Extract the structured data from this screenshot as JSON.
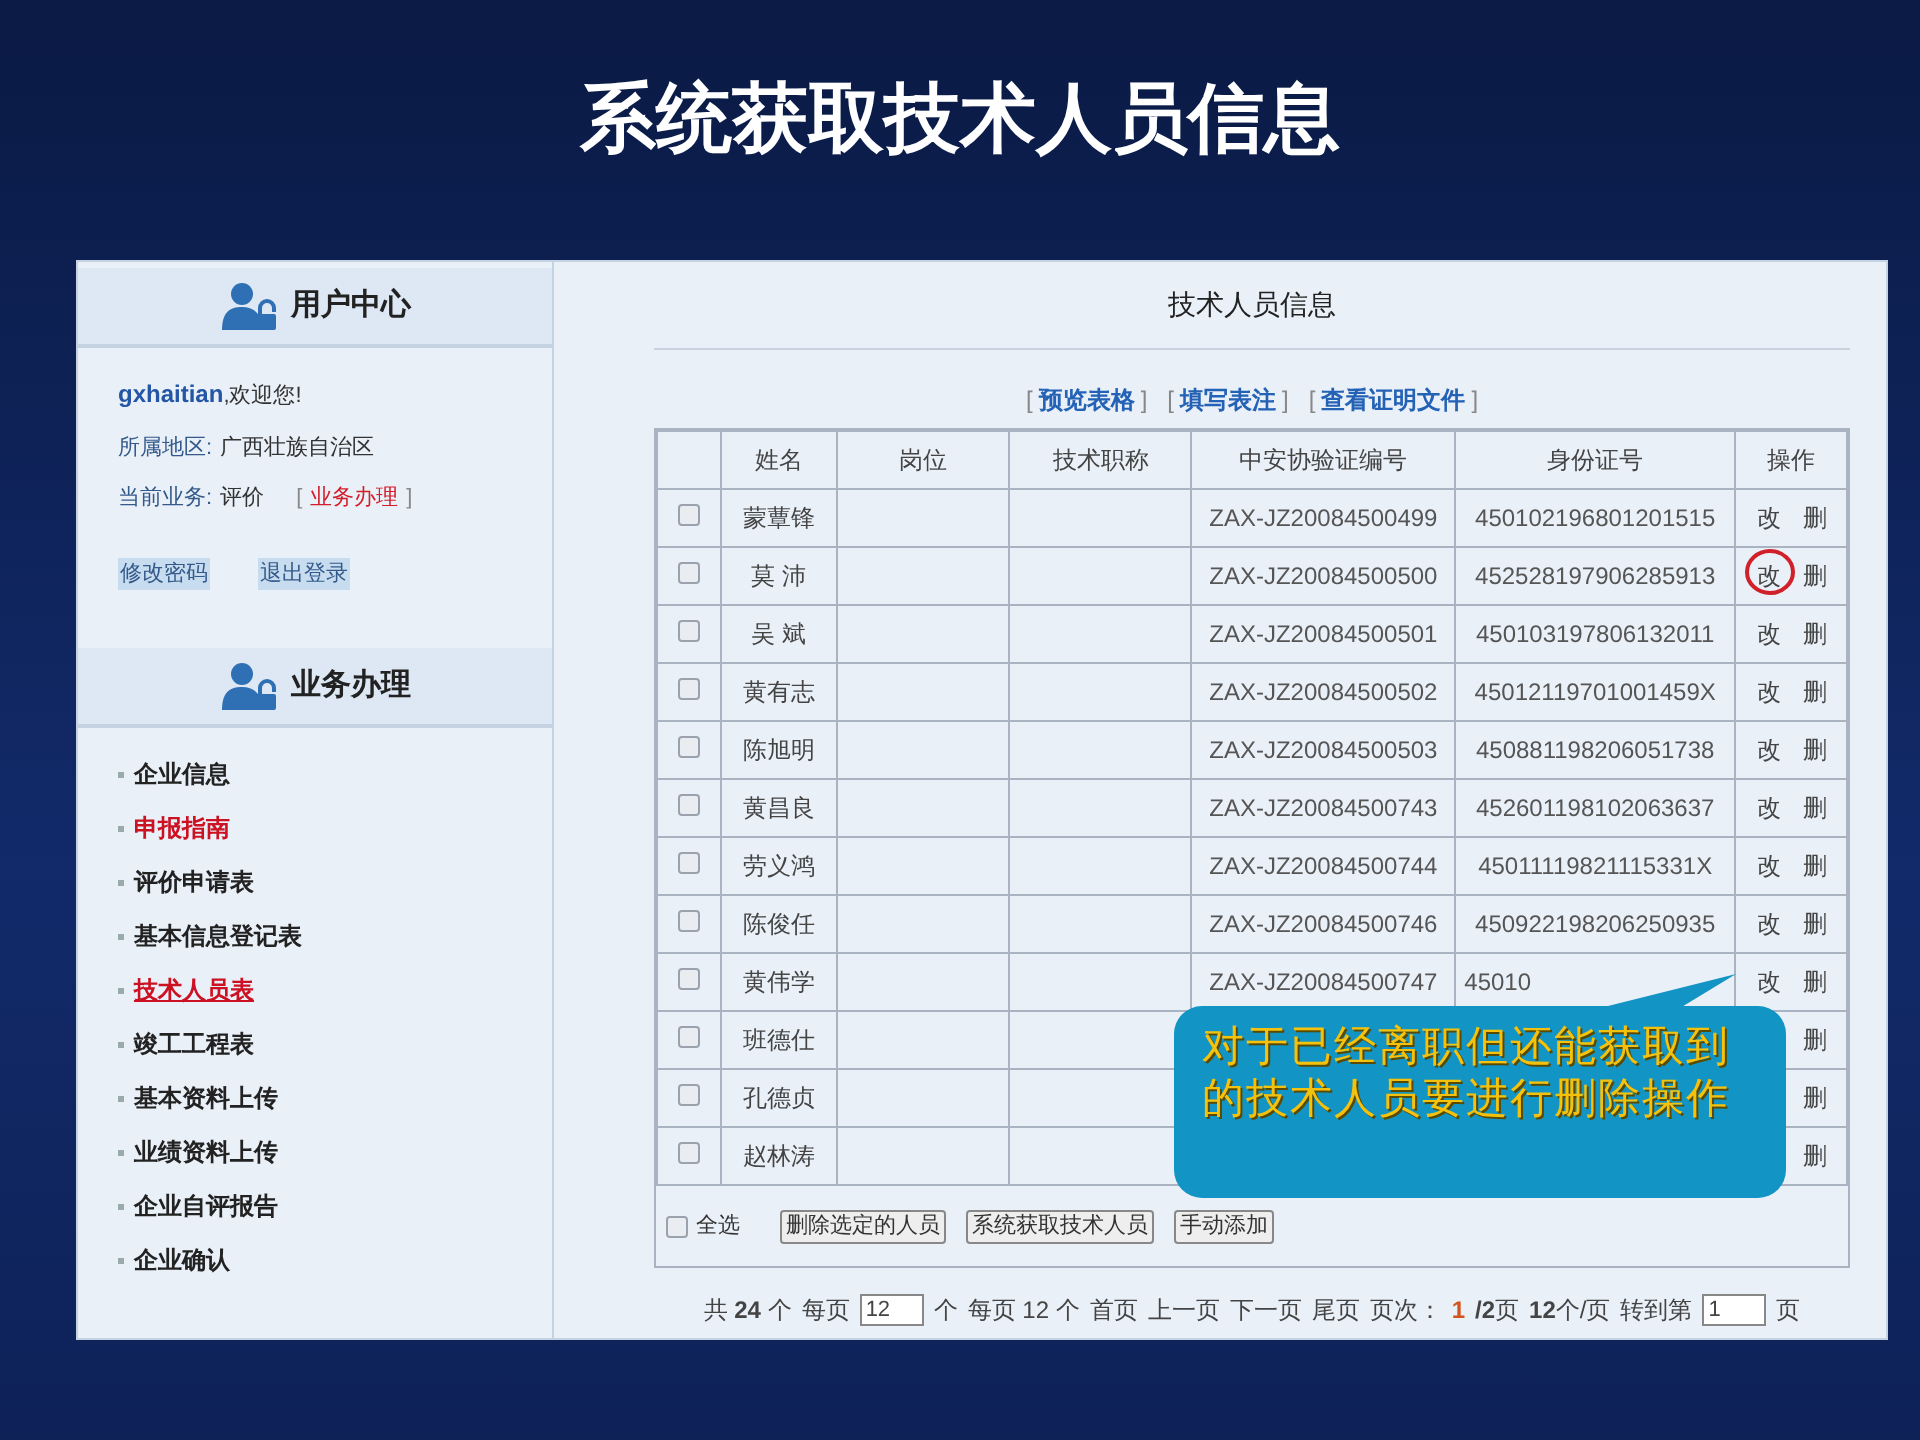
{
  "slide_title": "系统获取技术人员信息",
  "sidebar": {
    "user_center": {
      "title": "用户中心",
      "username": "gxhaitian",
      "greeting": ",欢迎您!",
      "region_label": "所属地区:",
      "region": "广西壮族自治区",
      "business_label": "当前业务:",
      "business": "评价",
      "business_link": {
        "left": "[",
        "label": "业务办理",
        "right": "]"
      },
      "links": [
        "修改密码",
        "退出登录"
      ]
    },
    "business": {
      "title": "业务办理",
      "items": [
        {
          "label": "企业信息",
          "kind": "plain",
          "selected": false
        },
        {
          "label": "申报指南",
          "kind": "alert",
          "selected": false
        },
        {
          "label": "评价申请表",
          "kind": "plain",
          "selected": false
        },
        {
          "label": "基本信息登记表",
          "kind": "plain",
          "selected": false
        },
        {
          "label": "技术人员表",
          "kind": "alert",
          "selected": true
        },
        {
          "label": "竣工工程表",
          "kind": "plain",
          "selected": false
        },
        {
          "label": "基本资料上传",
          "kind": "plain",
          "selected": false
        },
        {
          "label": "业绩资料上传",
          "kind": "plain",
          "selected": false
        },
        {
          "label": "企业自评报告",
          "kind": "plain",
          "selected": false
        },
        {
          "label": "企业确认",
          "kind": "plain",
          "selected": false
        }
      ]
    }
  },
  "main": {
    "title": "技术人员信息",
    "links": [
      {
        "left": "[",
        "label": "预览表格",
        "right": "]"
      },
      {
        "left": "[",
        "label": "填写表注",
        "right": "]"
      },
      {
        "left": "[",
        "label": "查看证明文件",
        "right": "]"
      }
    ],
    "table": {
      "columns": [
        "姓名",
        "岗位",
        "技术职称",
        "中安协验证编号",
        "身份证号",
        "操作"
      ],
      "rows": [
        {
          "checked": false,
          "name": "蒙蕈锋",
          "cert": "ZAX-JZ20084500499",
          "id": "450102196801201515",
          "edit": "改",
          "delete": "删",
          "circled": false
        },
        {
          "checked": false,
          "name": "莫 沛",
          "cert": "ZAX-JZ20084500500",
          "id": "452528197906285913",
          "edit": "改",
          "delete": "删",
          "circled": true
        },
        {
          "checked": false,
          "name": "吴 斌",
          "cert": "ZAX-JZ20084500501",
          "id": "450103197806132011",
          "edit": "改",
          "delete": "删",
          "circled": false
        },
        {
          "checked": false,
          "name": "黄有志",
          "cert": "ZAX-JZ20084500502",
          "id": "45012119701001459X",
          "edit": "改",
          "delete": "删",
          "circled": false
        },
        {
          "checked": false,
          "name": "陈旭明",
          "cert": "ZAX-JZ20084500503",
          "id": "450881198206051738",
          "edit": "改",
          "delete": "删",
          "circled": false
        },
        {
          "checked": false,
          "name": "黄昌良",
          "cert": "ZAX-JZ20084500743",
          "id": "452601198102063637",
          "edit": "改",
          "delete": "删",
          "circled": false
        },
        {
          "checked": false,
          "name": "劳义鸿",
          "cert": "ZAX-JZ20084500744",
          "id": "45011119821115331X",
          "edit": "改",
          "delete": "删",
          "circled": false
        },
        {
          "checked": false,
          "name": "陈俊任",
          "cert": "ZAX-JZ20084500746",
          "id": "450922198206250935",
          "edit": "改",
          "delete": "删",
          "circled": false
        },
        {
          "checked": false,
          "name": "黄伟学",
          "cert": "ZAX-JZ20084500747",
          "id": "45010",
          "edit": "改",
          "delete": "删",
          "circled": false
        },
        {
          "checked": false,
          "name": "班德仕",
          "delete": "删"
        },
        {
          "checked": false,
          "name": "孔德贞",
          "delete": "删"
        },
        {
          "checked": false,
          "name": "赵林涛",
          "delete": "删"
        }
      ]
    },
    "select_all": {
      "label": "全选",
      "checked": false
    },
    "buttons": [
      "删除选定的人员",
      "系统获取技术人员",
      "手动添加"
    ],
    "pagination": [
      {
        "kind": "text",
        "text": "共 **24** 个"
      },
      {
        "kind": "text",
        "text": "每页"
      },
      {
        "kind": "input",
        "text": "12"
      },
      {
        "kind": "text",
        "text": "个"
      },
      {
        "kind": "text",
        "text": "每页 12 个"
      },
      {
        "kind": "link",
        "text": "首页"
      },
      {
        "kind": "link",
        "text": "上一页"
      },
      {
        "kind": "link",
        "text": "下一页"
      },
      {
        "kind": "link",
        "text": "尾页"
      },
      {
        "kind": "text",
        "text": "页次："
      },
      {
        "kind": "current",
        "text": "1"
      },
      {
        "kind": "text",
        "text": "**/2**页"
      },
      {
        "kind": "text",
        "text": "**12**个/页"
      },
      {
        "kind": "text",
        "text": "转到第"
      },
      {
        "kind": "input",
        "text": "1"
      },
      {
        "kind": "text",
        "text": "页"
      }
    ]
  },
  "callout": {
    "text": "对于已经离职但还能获取到的技术人员要进行删除操作"
  }
}
